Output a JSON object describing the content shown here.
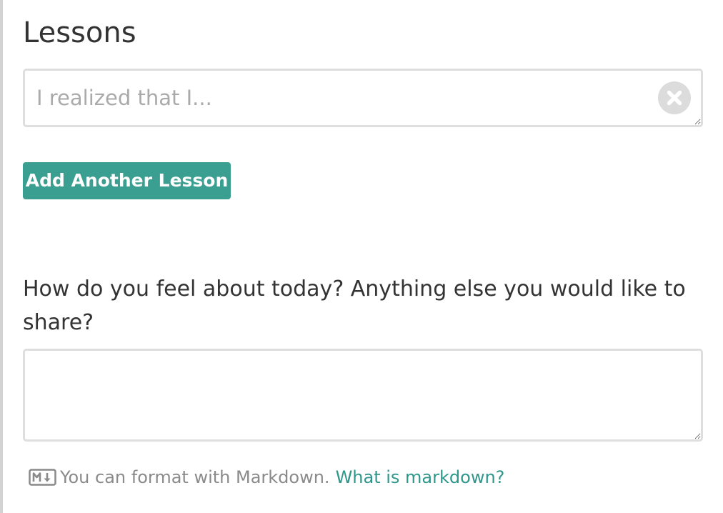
{
  "lessons_section": {
    "title": "Lessons",
    "input": {
      "value": "",
      "placeholder": "I realized that I..."
    },
    "clear_icon": "times-circle-icon",
    "add_button_label": "Add Another Lesson"
  },
  "share_section": {
    "prompt": "How do you feel about today? Anything else you would like to share?",
    "input": {
      "value": "",
      "placeholder": ""
    }
  },
  "markdown_hint": {
    "icon": "markdown-icon",
    "text": "You can format with Markdown.",
    "link_label": "What is markdown?"
  },
  "colors": {
    "accent": "#3a9e91",
    "link": "#2e968a",
    "text": "#333333",
    "muted_text": "#8a8a8a",
    "input_border": "#dedede",
    "clear_icon_bg": "#dcdcdc"
  }
}
